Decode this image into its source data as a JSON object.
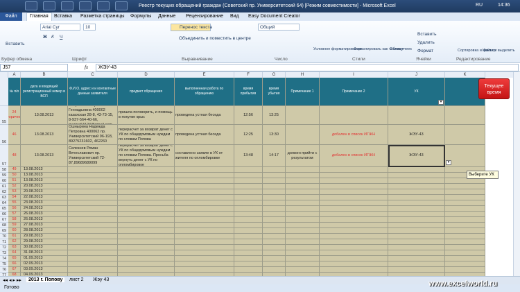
{
  "window": {
    "title": "Реестр текущих обращений граждан (Советский пр. Университетский 64)  [Режим совместимости]  -  Microsoft Excel",
    "lang": "RU",
    "clock": "14:36"
  },
  "tabs": {
    "file": "Файл",
    "items": [
      "Главная",
      "Вставка",
      "Разметка страницы",
      "Формулы",
      "Данные",
      "Рецензирование",
      "Вид",
      "Easy Document Creator"
    ]
  },
  "ribbon": {
    "paste": "Вставить",
    "clipboard": "Буфер обмена",
    "font_name": "Arial Cyr",
    "font_size": "10",
    "font_group": "Шрифт",
    "wrap": "Перенос текста",
    "merge": "Объединить и поместить в центре",
    "align_group": "Выравнивание",
    "number_format": "Общий",
    "number_group": "Число",
    "cond_format": "Условное форматирование",
    "format_table": "Форматировать как таблицу",
    "cell_styles": "Стили ячеек",
    "styles_group": "Стили",
    "insert": "Вставить",
    "delete": "Удалить",
    "format": "Формат",
    "cells_group": "Ячейки",
    "sort": "Сортировка и фильтр",
    "find": "Найти и выделить",
    "edit_group": "Редактирование"
  },
  "formula": {
    "name": "J57",
    "fx": "fx",
    "value": "ЖЭУ-43"
  },
  "columns": [
    "A",
    "B",
    "C",
    "D",
    "E",
    "F",
    "G",
    "H",
    "I",
    "J",
    "K"
  ],
  "headers": {
    "a": "№ п/о",
    "b": "дата и входящий регистрационный номер в ВСП",
    "c": "Ф.И.О. адрес и  и контактные данные заявителя",
    "d": "предмет обращения",
    "e": "выполненная работа по обращению",
    "f": "время прибытия",
    "g": "время убытия",
    "h": "Примечание 1",
    "i": "Примечание 2",
    "j": "УК",
    "k": "Текущее время"
  },
  "rows": [
    {
      "n": "55",
      "a": "24 вторичное",
      "b": "13.08.2013",
      "c": "Лавриенко Марина Геннадьевна 400002 казахская 28-8, 43-73-15, 8-937-564-40-66, marina64124@gmail.com",
      "d": "пришла поговорить, и помощь в покупке крыс",
      "e": "проведена устная беседа",
      "f": "12:56",
      "g": "13:25",
      "h": "",
      "i": "",
      "j": ""
    },
    {
      "n": "56",
      "a": "46",
      "b": "13.08.2013",
      "c": "Ошнырина Надежда Петровна 400062 пр. Университетский 96-193, 89275231602, 462260",
      "d": "перерасчет за возврат денег с УК по общедомовым нуждам по словам Попова",
      "e": "проведена устная беседа",
      "f": "12:25",
      "g": "13:30",
      "h": "",
      "i": "добален в список ИГЖН",
      "j": "ЖЭУ-43"
    },
    {
      "n": "57",
      "a": "48",
      "b": "13.08.2013",
      "c": "Селезнев Роман Вячеславович пр. Университетский 72-87,89689689099",
      "d": "перерасчет за возврат денег с УК по общедомовым нуждам по словам Попова. Просьба вернуть денег с УК по опломбировке",
      "e": "составлено заявле в УК от жителя по опломбировке",
      "f": "13:48",
      "g": "14:17",
      "h": "должен прийти с результатом",
      "i": "добален в список ИГЖН",
      "j": "ЖЭУ-43"
    }
  ],
  "simple_rows": [
    {
      "n": "58",
      "a": "49",
      "b": "13.08.2013"
    },
    {
      "n": "59",
      "a": "50",
      "b": "13.08.2013"
    },
    {
      "n": "60",
      "a": "51",
      "b": "13.08.2013"
    },
    {
      "n": "61",
      "a": "52",
      "b": "20.08.2013"
    },
    {
      "n": "62",
      "a": "53",
      "b": "20.08.2013"
    },
    {
      "n": "63",
      "a": "54",
      "b": "22.08.2013"
    },
    {
      "n": "64",
      "a": "55",
      "b": "23.08.2013"
    },
    {
      "n": "65",
      "a": "56",
      "b": "24.08.2013"
    },
    {
      "n": "66",
      "a": "57",
      "b": "26.08.2013"
    },
    {
      "n": "67",
      "a": "58",
      "b": "26.08.2013"
    },
    {
      "n": "68",
      "a": "59",
      "b": "27.08.2013"
    },
    {
      "n": "69",
      "a": "60",
      "b": "28.08.2013"
    },
    {
      "n": "70",
      "a": "61",
      "b": "29.08.2013"
    },
    {
      "n": "71",
      "a": "62",
      "b": "29.08.2013"
    },
    {
      "n": "72",
      "a": "63",
      "b": "30.08.2013"
    },
    {
      "n": "73",
      "a": "64",
      "b": "31.08.2013"
    },
    {
      "n": "74",
      "a": "65",
      "b": "01.09.2013"
    },
    {
      "n": "75",
      "a": "66",
      "b": "02.09.2013"
    },
    {
      "n": "76",
      "a": "67",
      "b": "03.09.2013"
    },
    {
      "n": "77",
      "a": "68",
      "b": "04.09.2013"
    }
  ],
  "tooltip": "Выберите УК",
  "sheets": [
    "2013 г. Попову",
    "лист 2",
    "Жэу 43"
  ],
  "status": "Готово",
  "watermark": "www.excelworld.ru",
  "colors": {
    "header": "#1f6f86",
    "olive": "#cfc9a8",
    "red": "#e23030",
    "button": "#d32020"
  }
}
